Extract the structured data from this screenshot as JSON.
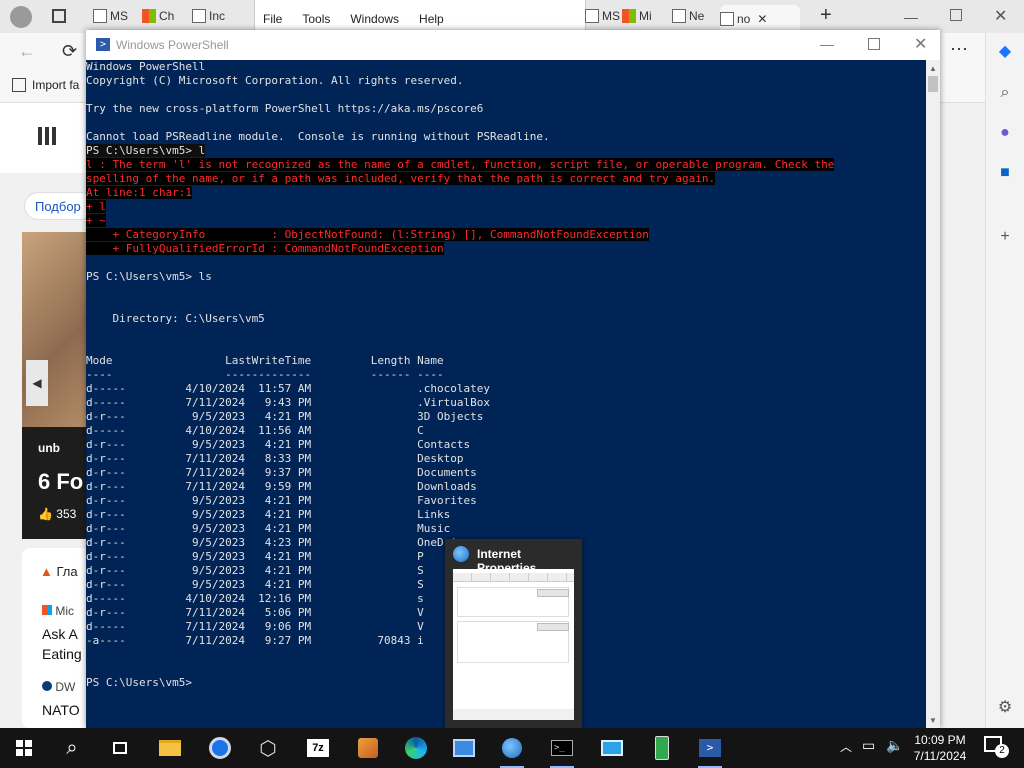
{
  "browser": {
    "tabs": [
      "MS",
      "Ch",
      "Inc",
      "MS",
      "Mi",
      "Ne",
      "no"
    ],
    "menubar": [
      "File",
      "Tools",
      "Windows",
      "Help"
    ],
    "favorites_import": "Import fa",
    "feed_button": "Подбор",
    "feed_texts": {
      "source": "unb",
      "headline": "6 Fo",
      "likes": "353",
      "item1": "Гла",
      "item2_source": "Mic",
      "item2_line1": "Ask A",
      "item2_line2": "Eating",
      "item3_source": "DW",
      "item3_line1": "NATO"
    }
  },
  "powershell": {
    "title": "Windows PowerShell",
    "lines": {
      "l01": "Windows PowerShell",
      "l02": "Copyright (C) Microsoft Corporation. All rights reserved.",
      "l03": "",
      "l04": "Try the new cross-platform PowerShell https://aka.ms/pscore6",
      "l05": "",
      "l06": "Cannot load PSReadline module.  Console is running without PSReadline.",
      "l07": "PS C:\\Users\\vm5> l",
      "e08": "l : The term 'l' is not recognized as the name of a cmdlet, function, script file, or operable program. Check the",
      "e09": "spelling of the name, or if a path was included, verify that the path is correct and try again.",
      "e10": "At line:1 char:1",
      "e11": "+ l",
      "e12": "+ ~",
      "e13": "    + CategoryInfo          : ObjectNotFound: (l:String) [], CommandNotFoundException",
      "e14": "    + FullyQualifiedErrorId : CommandNotFoundException",
      "l15": "",
      "l16": "PS C:\\Users\\vm5> ls",
      "l17": "",
      "l18": "",
      "l19": "    Directory: C:\\Users\\vm5",
      "l20": "",
      "l21": "",
      "l22": "Mode                 LastWriteTime         Length Name",
      "l23": "----                 -------------         ------ ----",
      "r01": "d-----         4/10/2024  11:57 AM                .chocolatey",
      "r02": "d-----         7/11/2024   9:43 PM                .VirtualBox",
      "r03": "d-r---          9/5/2023   4:21 PM                3D Objects",
      "r04": "d-----         4/10/2024  11:56 AM                C",
      "r05": "d-r---          9/5/2023   4:21 PM                Contacts",
      "r06": "d-r---         7/11/2024   8:33 PM                Desktop",
      "r07": "d-r---         7/11/2024   9:37 PM                Documents",
      "r08": "d-r---         7/11/2024   9:59 PM                Downloads",
      "r09": "d-r---          9/5/2023   4:21 PM                Favorites",
      "r10": "d-r---          9/5/2023   4:21 PM                Links",
      "r11": "d-r---          9/5/2023   4:21 PM                Music",
      "r12": "d-r---          9/5/2023   4:23 PM                OneDrive",
      "r13": "d-r---          9/5/2023   4:21 PM                P",
      "r14": "d-r---          9/5/2023   4:21 PM                S",
      "r15": "d-r---          9/5/2023   4:21 PM                S",
      "r16": "d-----         4/10/2024  12:16 PM                s",
      "r17": "d-r---         7/11/2024   5:06 PM                V",
      "r18": "d-----         7/11/2024   9:06 PM                V",
      "r19": "-a----         7/11/2024   9:27 PM          70843 i",
      "l24": "",
      "l25": "",
      "l26": "PS C:\\Users\\vm5>"
    }
  },
  "thumbnail": {
    "title": "Internet Properties"
  },
  "taskbar": {
    "time": "10:09 PM",
    "date": "7/11/2024",
    "notification_count": "2",
    "badge_7z": "7z"
  },
  "colors": {
    "console_bg": "#012456",
    "console_text": "#e2e2e2",
    "error_text": "#ff2a2a",
    "taskbar_bg": "#141414"
  }
}
